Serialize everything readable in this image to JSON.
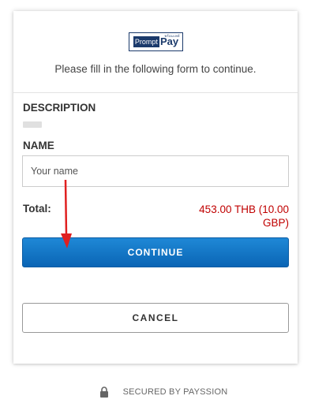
{
  "header": {
    "logo_prompt": "Prompt",
    "logo_pay": "Pay",
    "logo_small": "พร้อมเพย์",
    "subtitle": "Please fill in the following form to continue."
  },
  "form": {
    "description_label": "DESCRIPTION",
    "name_label": "NAME",
    "name_placeholder": "Your name",
    "name_value": "",
    "total_label": "Total:",
    "total_amount": "453.00 THB (10.00 GBP)"
  },
  "buttons": {
    "continue_label": "CONTINUE",
    "cancel_label": "CANCEL"
  },
  "footer": {
    "secured_text": "SECURED BY PAYSSION"
  },
  "colors": {
    "accent": "#0a65b5",
    "total_amount": "#c00000",
    "annotation_arrow": "#e02020"
  },
  "icons": {
    "footer_icon": "lock-icon",
    "annotation": "arrow-icon"
  }
}
